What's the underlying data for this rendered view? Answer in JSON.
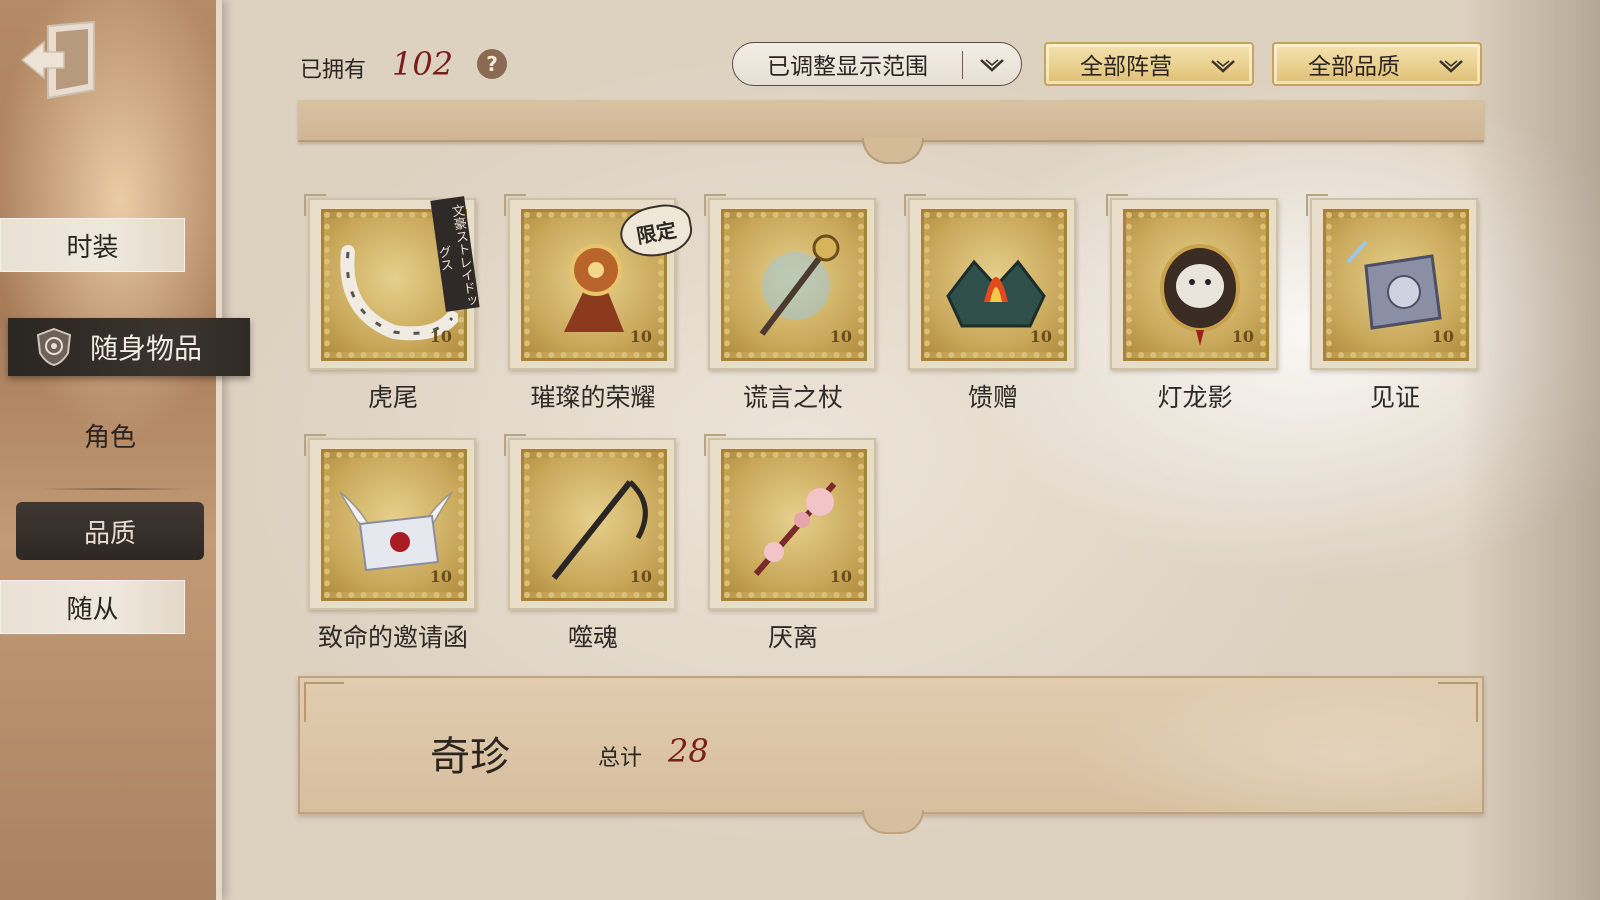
{
  "sidebar": {
    "exit_icon": "exit-door-icon",
    "tabs": [
      {
        "label": "时装"
      },
      {
        "label": "随身物品"
      },
      {
        "label": "角色"
      },
      {
        "label": "品质"
      },
      {
        "label": "随从"
      }
    ]
  },
  "header": {
    "owned_label": "已拥有",
    "owned_count": "102",
    "help_glyph": "?"
  },
  "filters": {
    "range_label": "已调整显示范围",
    "camp_label": "全部阵营",
    "quality_label": "全部品质"
  },
  "items": [
    {
      "name": "虎尾",
      "stamp_value": "10",
      "tag": "文豪ストレイドッグス"
    },
    {
      "name": "璀璨的荣耀",
      "stamp_value": "10",
      "tag": "限定"
    },
    {
      "name": "谎言之杖",
      "stamp_value": "10"
    },
    {
      "name": "馈赠",
      "stamp_value": "10"
    },
    {
      "name": "灯龙影",
      "stamp_value": "10"
    },
    {
      "name": "见证",
      "stamp_value": "10"
    },
    {
      "name": "致命的邀请函",
      "stamp_value": "10"
    },
    {
      "name": "噬魂",
      "stamp_value": "10"
    },
    {
      "name": "厌离",
      "stamp_value": "10"
    }
  ],
  "section": {
    "title": "奇珍",
    "total_label": "总计",
    "total_count": "28"
  },
  "colors": {
    "accent_red": "#7a1e1a",
    "gold": "#e9cf8c",
    "sidebar_active": "#2a2622"
  }
}
